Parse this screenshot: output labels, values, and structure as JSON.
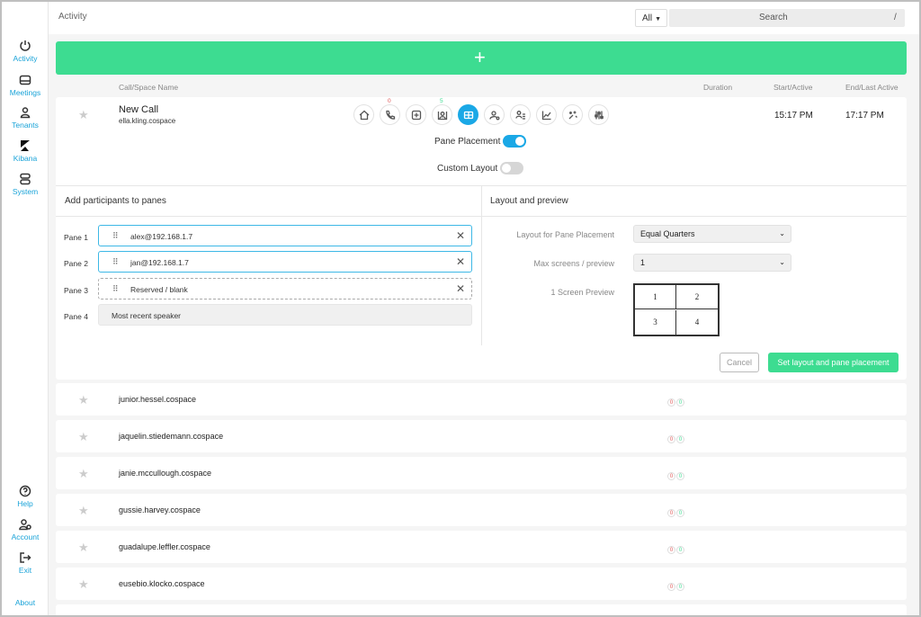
{
  "nav": {
    "top": [
      {
        "label": "Activity",
        "icon": "activity-icon"
      },
      {
        "label": "Meetings",
        "icon": "meetings-icon"
      },
      {
        "label": "Tenants",
        "icon": "tenants-icon"
      },
      {
        "label": "Kibana",
        "icon": "kibana-icon"
      },
      {
        "label": "System",
        "icon": "system-icon"
      }
    ],
    "bottom": [
      {
        "label": "Help",
        "icon": "help-icon"
      },
      {
        "label": "Account",
        "icon": "account-icon"
      },
      {
        "label": "Exit",
        "icon": "exit-icon"
      },
      {
        "label": "About",
        "icon": ""
      }
    ]
  },
  "header": {
    "title": "Activity",
    "filter": "All",
    "search_placeholder": "Search",
    "search_shortcut": "/"
  },
  "add_button": "+",
  "columns": {
    "name": "Call/Space Name",
    "duration": "Duration",
    "start": "Start/Active",
    "end": "End/Last Active"
  },
  "active_call": {
    "name": "New Call",
    "sub": "ella.kling.cospace",
    "start": "15:17 PM",
    "end": "17:17 PM",
    "tool_badges": {
      "phone": "0",
      "participants": "5"
    },
    "pane_placement_label": "Pane Placement",
    "custom_layout_label": "Custom Layout",
    "add_participants_title": "Add participants to panes",
    "layout_title": "Layout and preview",
    "panes": [
      {
        "label": "Pane 1",
        "value": "alex@192.168.1.7"
      },
      {
        "label": "Pane 2",
        "value": "jan@192.168.1.7"
      },
      {
        "label": "Pane 3",
        "value": "Reserved / blank"
      },
      {
        "label": "Pane 4",
        "value": "Most recent speaker"
      }
    ],
    "layout_label": "Layout for Pane Placement",
    "layout_value": "Equal Quarters",
    "max_screens_label": "Max screens / preview",
    "max_screens_value": "1",
    "preview_label": "1 Screen Preview",
    "preview_cells": [
      "1",
      "2",
      "3",
      "4"
    ],
    "cancel": "Cancel",
    "submit": "Set layout and pane placement"
  },
  "rows": [
    {
      "name": "junior.hessel.cospace",
      "a": "0",
      "b": "0"
    },
    {
      "name": "jaquelin.stiedemann.cospace",
      "a": "0",
      "b": "0"
    },
    {
      "name": "janie.mccullough.cospace",
      "a": "0",
      "b": "0"
    },
    {
      "name": "gussie.harvey.cospace",
      "a": "0",
      "b": "0"
    },
    {
      "name": "guadalupe.leffler.cospace",
      "a": "0",
      "b": "0"
    },
    {
      "name": "eusebio.klocko.cospace",
      "a": "0",
      "b": "0"
    }
  ],
  "colors": {
    "accent": "#1aa8e6",
    "green": "#3ddc91",
    "red": "#e05555"
  }
}
